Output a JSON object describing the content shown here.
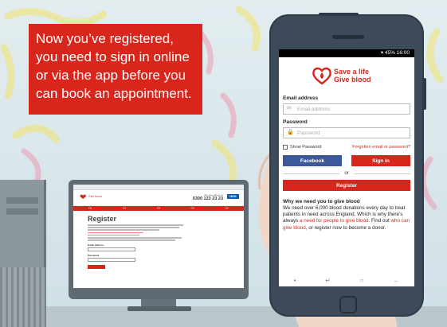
{
  "callout": {
    "line1": "Now you’ve registered,",
    "line2": "you need to sign in online",
    "line3": "or via the app before you",
    "line4": "can book an appointment."
  },
  "colors": {
    "brand_red": "#d9261c",
    "facebook_blue": "#3b5998",
    "nhs_blue": "#005eb8"
  },
  "desktop": {
    "site_logo_text": "Give blood",
    "call_text": "You can call us on",
    "phone_number": "0300 123 23 23",
    "nhs_badge": "NHS",
    "page_title": "Register",
    "email_label": "Email address",
    "password_label": "Password"
  },
  "phone": {
    "status_text": "45% 16:00",
    "brand_line1": "Save a life",
    "brand_line2": "Give blood",
    "email_label": "Email address",
    "email_placeholder": "Email address",
    "password_label": "Password",
    "password_placeholder": "Password",
    "show_password": "Show Password",
    "forgot_link": "Forgotten email or password?",
    "facebook_button": "Facebook",
    "signin_button": "Sign in",
    "or_divider": "or",
    "register_button": "Register",
    "why_title": "Why we need you to give blood",
    "why_text_1": "We need over 6,000 blood donations every day to treat patients in need across England. Which is why there’s always ",
    "why_link_1": "a need for people to give blood",
    "why_text_2": ". Find out ",
    "why_link_2": "who can give blood",
    "why_text_3": ", or register now to become a donor."
  },
  "icons": {
    "heart": "heart-icon",
    "email": "envelope-icon",
    "password": "lock-icon",
    "back": "back-arrow-icon",
    "home": "home-icon",
    "recent": "recent-apps-icon"
  }
}
